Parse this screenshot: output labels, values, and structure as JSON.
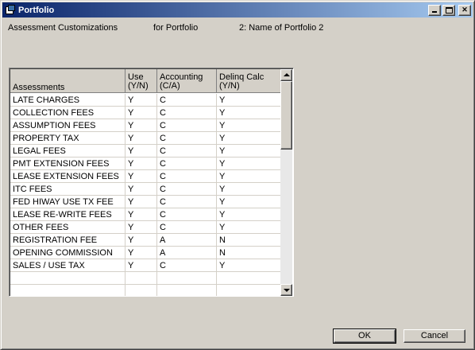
{
  "window": {
    "title": "Portfolio"
  },
  "header": {
    "section": "Assessment Customizations",
    "for_label": "for Portfolio",
    "portfolio": "2: Name of Portfolio 2"
  },
  "grid": {
    "columns": [
      "Assessments",
      "Use\n(Y/N)",
      "Accounting\n(C/A)",
      "Delinq Calc\n(Y/N)"
    ],
    "rows": [
      [
        "LATE CHARGES",
        "Y",
        "C",
        "Y"
      ],
      [
        "COLLECTION FEES",
        "Y",
        "C",
        "Y"
      ],
      [
        "ASSUMPTION FEES",
        "Y",
        "C",
        "Y"
      ],
      [
        "PROPERTY TAX",
        "Y",
        "C",
        "Y"
      ],
      [
        "LEGAL FEES",
        "Y",
        "C",
        "Y"
      ],
      [
        "PMT EXTENSION FEES",
        "Y",
        "C",
        "Y"
      ],
      [
        "LEASE EXTENSION FEES",
        "Y",
        "C",
        "Y"
      ],
      [
        "ITC FEES",
        "Y",
        "C",
        "Y"
      ],
      [
        "FED HIWAY USE TX FEE",
        "Y",
        "C",
        "Y"
      ],
      [
        "LEASE RE-WRITE FEES",
        "Y",
        "C",
        "Y"
      ],
      [
        "OTHER FEES",
        "Y",
        "C",
        "Y"
      ],
      [
        "REGISTRATION FEE",
        "Y",
        "A",
        "N"
      ],
      [
        "OPENING COMMISSION",
        "Y",
        "A",
        "N"
      ],
      [
        "SALES / USE TAX",
        "Y",
        "C",
        "Y"
      ],
      [
        "",
        "",
        "",
        ""
      ],
      [
        "",
        "",
        "",
        ""
      ]
    ]
  },
  "buttons": {
    "ok": "OK",
    "cancel": "Cancel"
  },
  "colors": {
    "titlebar_start": "#0a246a",
    "titlebar_end": "#a6caf0",
    "face": "#d4d0c8"
  }
}
